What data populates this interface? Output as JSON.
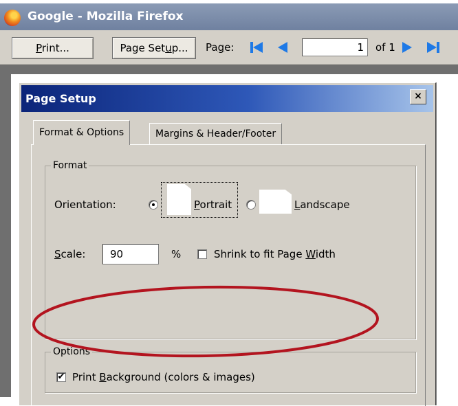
{
  "window": {
    "title": "Google - Mozilla Firefox"
  },
  "toolbar": {
    "print_prefix": "",
    "print_key": "P",
    "print_suffix": "rint...",
    "page_setup_prefix": "Page Set",
    "page_setup_key": "u",
    "page_setup_suffix": "p...",
    "page_prefix": "Pa",
    "page_key": "g",
    "page_suffix": "e:",
    "page_value": "1",
    "of_text": "of  1"
  },
  "dialog": {
    "title": "Page Setup",
    "close_glyph": "×",
    "tabs": [
      {
        "label": "Format & Options",
        "selected": true
      },
      {
        "label": "Margins & Header/Footer",
        "selected": false
      }
    ],
    "format": {
      "legend": "Format",
      "orientation_label": "Orientation:",
      "portrait_key": "P",
      "portrait_rest": "ortrait",
      "landscape_key": "L",
      "landscape_rest": "andscape",
      "selected_orientation": "portrait",
      "scale_key": "S",
      "scale_rest": "cale:",
      "scale_value": "90",
      "percent": "%",
      "shrink_prefix": "Shrink to fit Page ",
      "shrink_key": "W",
      "shrink_suffix": "idth",
      "shrink_checked": false
    },
    "options": {
      "legend": "Options",
      "print_bg_prefix": "Print ",
      "print_bg_key": "B",
      "print_bg_suffix": "ackground (colors & images)",
      "print_bg_checked": true
    }
  },
  "colors": {
    "nav_arrow": "#1e79e6",
    "annotation": "#b3141f",
    "dialog_title_dark": "#0b2479"
  }
}
